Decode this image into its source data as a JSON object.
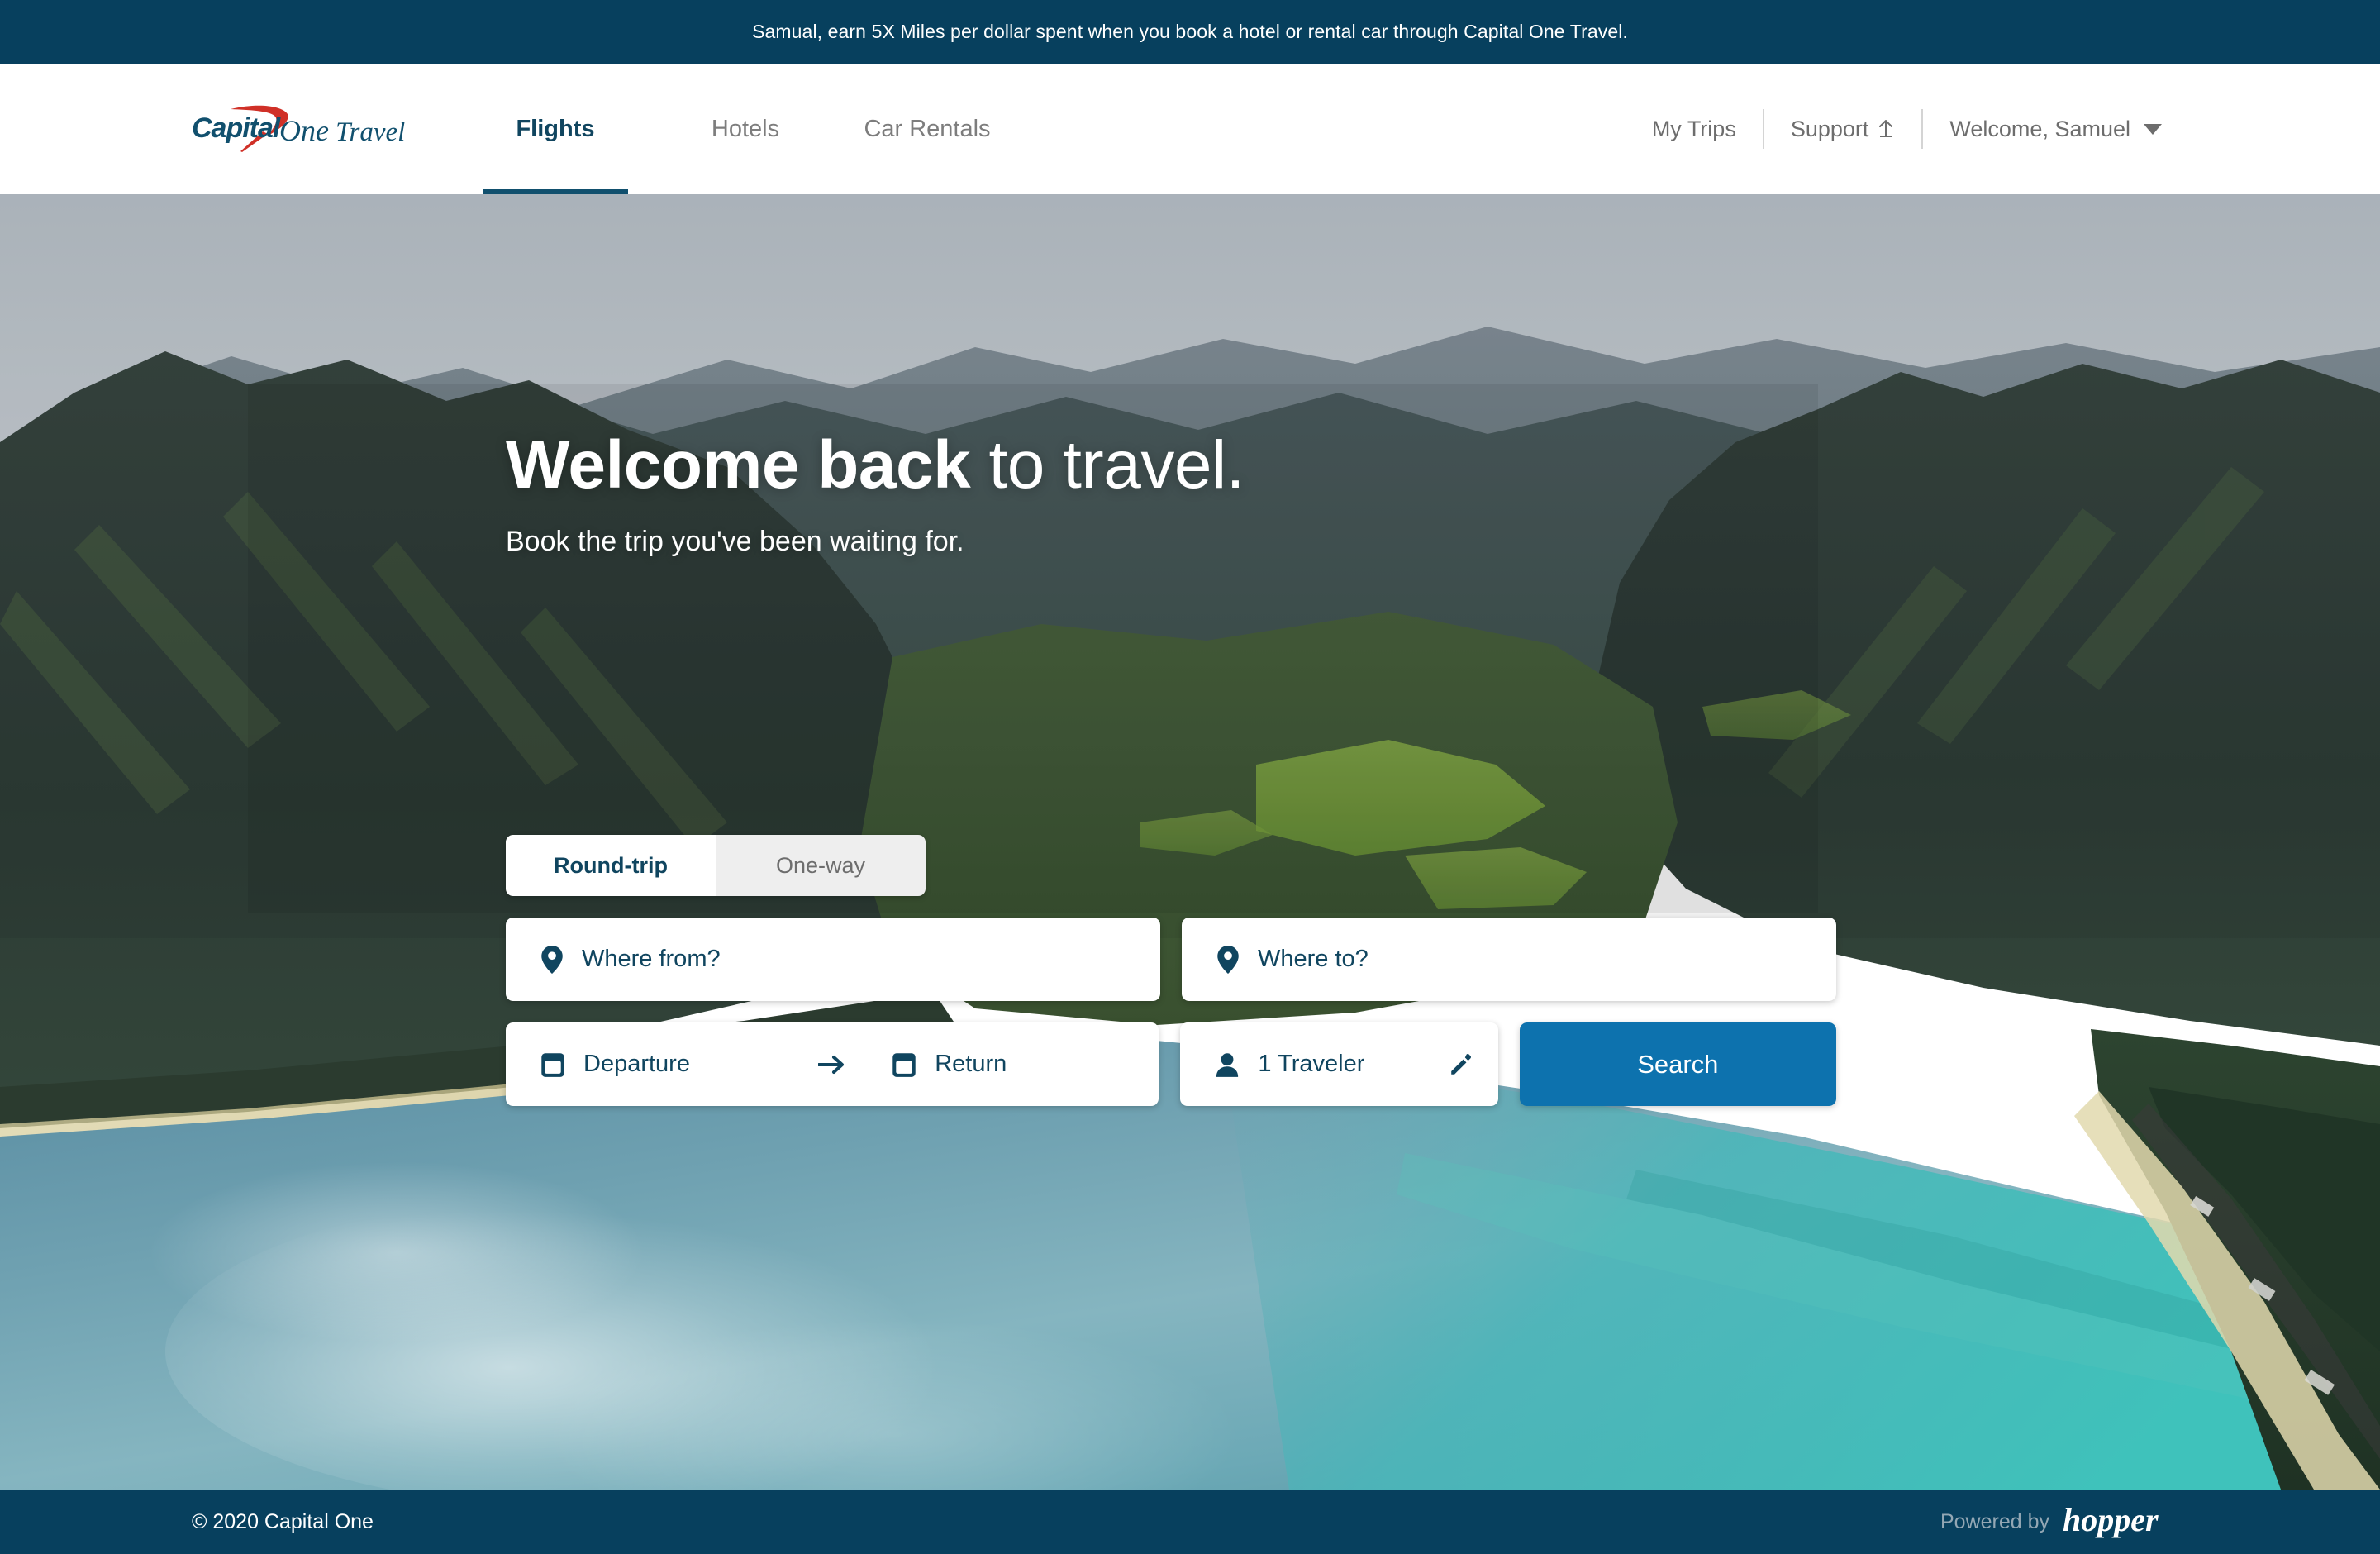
{
  "promo": {
    "text": "Samual, earn 5X Miles per dollar spent when you book a hotel or rental car through Capital One Travel."
  },
  "header": {
    "logo": {
      "capital": "Capital",
      "one": "One",
      "travel": "Travel"
    },
    "nav": [
      {
        "label": "Flights",
        "active": true
      },
      {
        "label": "Hotels",
        "active": false
      },
      {
        "label": "Car Rentals",
        "active": false
      }
    ],
    "right": {
      "my_trips": "My Trips",
      "support": "Support",
      "support_icon": "external-link-arrow-icon",
      "account": "Welcome, Samuel",
      "account_caret": "chevron-down-icon"
    }
  },
  "hero": {
    "title_bold": "Welcome back",
    "title_light": " to travel.",
    "subtitle": "Book the trip you've been waiting for."
  },
  "search": {
    "trip_types": [
      {
        "label": "Round-trip",
        "active": true
      },
      {
        "label": "One-way",
        "active": false
      }
    ],
    "origin": {
      "placeholder": "Where from?",
      "icon": "map-pin-icon"
    },
    "destination": {
      "placeholder": "Where to?",
      "icon": "map-pin-icon"
    },
    "departure": {
      "placeholder": "Departure",
      "icon": "calendar-icon"
    },
    "return": {
      "placeholder": "Return",
      "icon": "calendar-icon"
    },
    "date_separator_icon": "arrow-right-icon",
    "travelers": {
      "value": "1 Traveler",
      "icon": "person-icon",
      "edit_icon": "pencil-icon"
    },
    "search_button": "Search"
  },
  "footer": {
    "copyright": "© 2020 Capital One",
    "powered_by": "Powered by",
    "partner": "hopper"
  },
  "colors": {
    "brand_navy": "#07405e",
    "brand_red": "#d03027",
    "accent_blue": "#0d72ae",
    "text_navy": "#10455f",
    "muted_gray": "#6d6d6d"
  }
}
